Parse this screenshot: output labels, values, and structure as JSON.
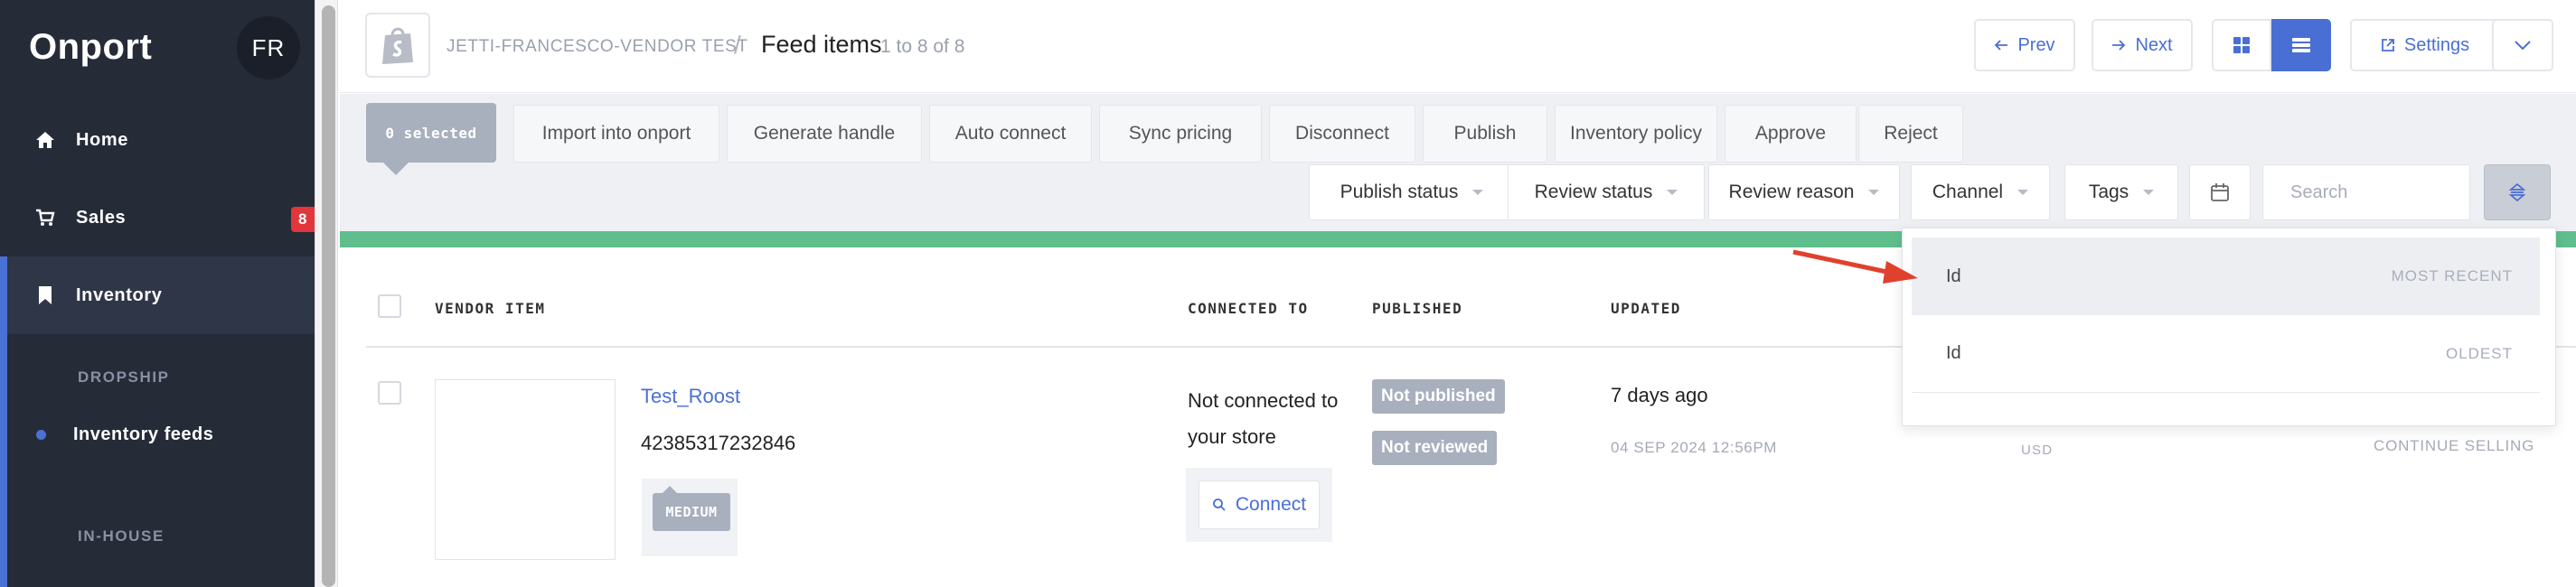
{
  "app": {
    "brand": "Onport",
    "avatar": "FR"
  },
  "sidebar": {
    "items": [
      {
        "label": "Home",
        "icon": "home-icon"
      },
      {
        "label": "Sales",
        "icon": "cart-icon",
        "badge": "8"
      },
      {
        "label": "Inventory",
        "icon": "bookmark-icon"
      }
    ],
    "section_dropship": "DROPSHIP",
    "sub_item": "Inventory feeds",
    "section_inhouse": "IN-HOUSE"
  },
  "header": {
    "store": "JETTI-FRANCESCO-VENDOR TEST",
    "separator": "/",
    "title": "Feed items",
    "count": "1 to 8 of 8",
    "prev": "Prev",
    "next": "Next",
    "settings": "Settings"
  },
  "toolbar": {
    "selected": "0 selected",
    "actions": [
      "Import into onport",
      "Generate handle",
      "Auto connect",
      "Sync pricing",
      "Disconnect",
      "Publish",
      "Inventory policy",
      "Approve",
      "Reject"
    ],
    "filters": [
      "Publish status",
      "Review status",
      "Review reason",
      "Channel",
      "Tags"
    ],
    "search_placeholder": "Search"
  },
  "table": {
    "columns": [
      "VENDOR ITEM",
      "CONNECTED TO",
      "PUBLISHED",
      "UPDATED"
    ],
    "rows": [
      {
        "name": "Test_Roost",
        "id": "42385317232846",
        "priority": "MEDIUM",
        "connection": "Not connected to your store",
        "connect": "Connect",
        "published": "Not published",
        "review": "Not reviewed",
        "updated_relative": "7 days ago",
        "updated_absolute": "04 SEP 2024 12:56PM",
        "currency": "USD",
        "inventory_policy": "CONTINUE SELLING"
      }
    ]
  },
  "sort_dropdown": {
    "options": [
      {
        "field": "Id",
        "order": "MOST RECENT"
      },
      {
        "field": "Id",
        "order": "OLDEST"
      }
    ]
  },
  "colors": {
    "accent": "#4a6fd4",
    "sidebar": "#262b38",
    "success": "#5ebf8d",
    "annotation": "#e0412c"
  }
}
